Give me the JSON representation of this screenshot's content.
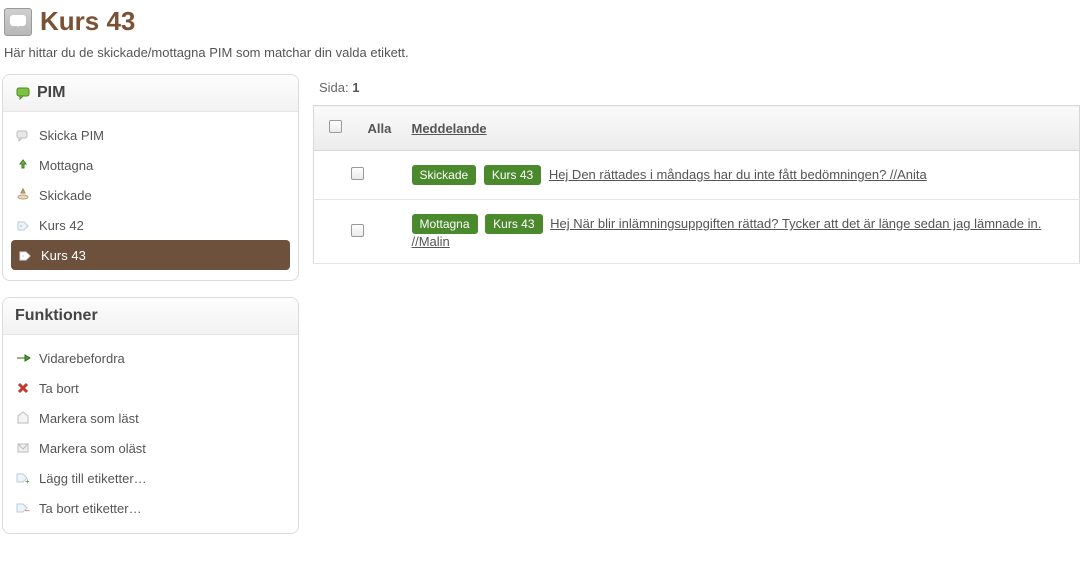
{
  "header": {
    "title": "Kurs 43",
    "description": "Här hittar du de skickade/mottagna PIM som matchar din valda etikett."
  },
  "sidebar": {
    "pim_title": "PIM",
    "items": [
      {
        "label": "Skicka PIM"
      },
      {
        "label": "Mottagna"
      },
      {
        "label": "Skickade"
      },
      {
        "label": "Kurs 42"
      },
      {
        "label": "Kurs 43"
      }
    ],
    "functions_title": "Funktioner",
    "functions": [
      {
        "label": "Vidarebefordra"
      },
      {
        "label": "Ta bort"
      },
      {
        "label": "Markera som läst"
      },
      {
        "label": "Markera som oläst"
      },
      {
        "label": "Lägg till etiketter…"
      },
      {
        "label": "Ta bort etiketter…"
      }
    ]
  },
  "main": {
    "page_label": "Sida:",
    "page_number": "1",
    "col_alla": "Alla",
    "col_msg": "Meddelande",
    "rows": [
      {
        "badge1": "Skickade",
        "badge2": "Kurs 43",
        "text": "Hej Den rättades i måndags har du inte fått bedömningen? //Anita"
      },
      {
        "badge1": "Mottagna",
        "badge2": "Kurs 43",
        "text": "Hej När blir inlämningsuppgiften rättad? Tycker att det är länge sedan jag lämnade in. //Malin"
      }
    ]
  }
}
